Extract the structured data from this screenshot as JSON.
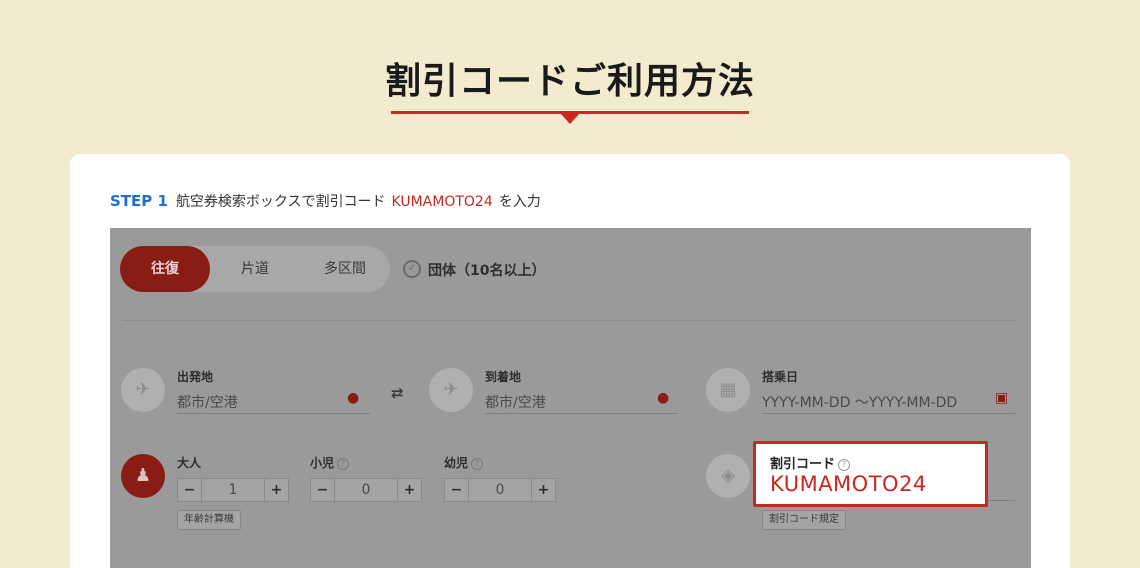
{
  "page": {
    "title": "割引コードご利用方法"
  },
  "step": {
    "number": "STEP 1",
    "text_before": "航空券検索ボックスで割引コード",
    "code": "KUMAMOTO24",
    "text_after": "を入力"
  },
  "search_form": {
    "trip_types": [
      {
        "label": "往復",
        "selected": true
      },
      {
        "label": "片道",
        "selected": false
      },
      {
        "label": "多区間",
        "selected": false
      }
    ],
    "group_option": {
      "label": "団体（10名以上）",
      "checked": false
    },
    "origin": {
      "label": "出発地",
      "placeholder": "都市/空港",
      "icon": "plane-takeoff-icon"
    },
    "destination": {
      "label": "到着地",
      "placeholder": "都市/空港",
      "icon": "plane-landing-icon"
    },
    "dates": {
      "label": "搭乗日",
      "placeholder": "YYYY-MM-DD ～YYYY-MM-DD",
      "icon": "calendar-icon"
    },
    "passengers": {
      "adult": {
        "label": "大人",
        "value": "1"
      },
      "child": {
        "label": "小児",
        "value": "0"
      },
      "infant": {
        "label": "幼児",
        "value": "0"
      },
      "age_calc_button": "年齢計算機"
    },
    "discount_code": {
      "label": "割引コード",
      "value": "KUMAMOTO24",
      "rules_button": "割引コード規定",
      "icon": "tag-icon"
    }
  },
  "colors": {
    "background": "#f3ebcf",
    "accent_red": "#c8281e",
    "step_blue": "#1a6fd0",
    "overlay_gray": "#9a9a9a"
  }
}
